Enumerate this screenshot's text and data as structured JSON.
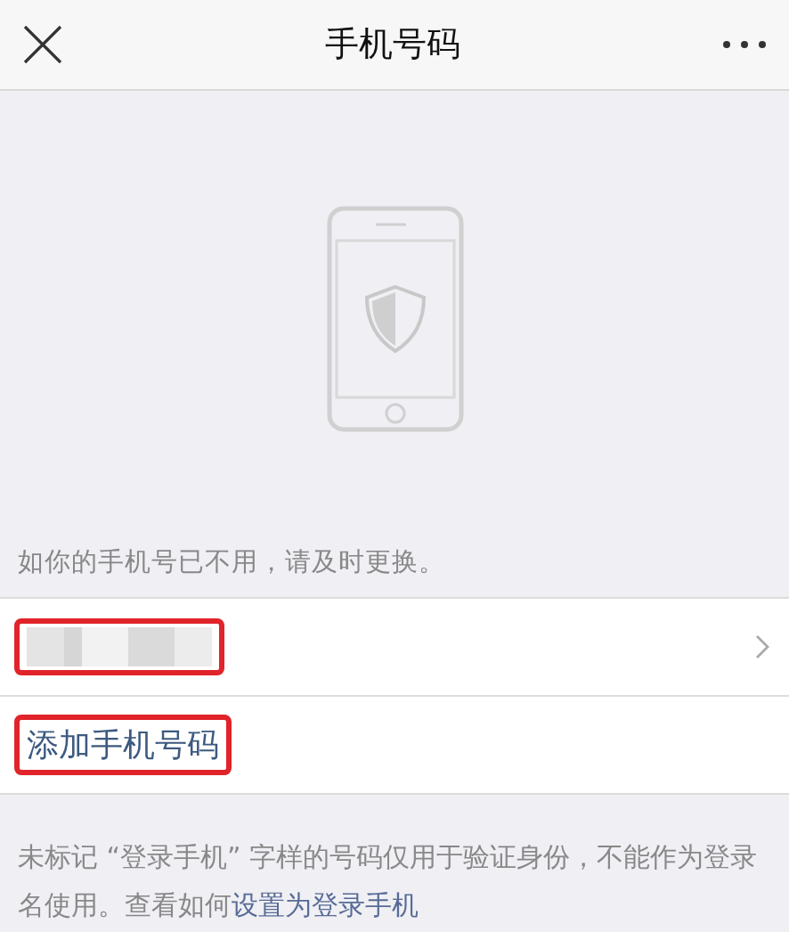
{
  "header": {
    "title": "手机号码"
  },
  "hint": "如你的手机号已不用，请及时更换。",
  "rows": [
    {
      "kind": "redacted",
      "highlighted": true
    },
    {
      "kind": "action",
      "label": "添加手机号码",
      "highlighted": true
    }
  ],
  "footer": {
    "text": "未标记 “登录手机” 字样的号码仅用于验证身份，不能作为登录名使用。查看如何",
    "link": "设置为登录手机"
  }
}
